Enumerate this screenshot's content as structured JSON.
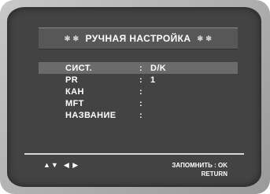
{
  "osd": {
    "title": "РУЧНАЯ НАСТРОЙКА",
    "title_decoration": "✻ ✻",
    "rows": [
      {
        "label": "СИСТ.",
        "colon": ":",
        "value": "D/K"
      },
      {
        "label": "PR",
        "colon": ":",
        "value": "1"
      },
      {
        "label": "КАН",
        "colon": ":",
        "value": ""
      },
      {
        "label": "MFT",
        "colon": ":",
        "value": ""
      },
      {
        "label": "НАЗВАНИЕ",
        "colon": ":",
        "value": ""
      }
    ],
    "footer": {
      "nav_updown": "▲▼",
      "nav_leftright": "◀ ▶",
      "save_hint": "ЗАПОМНИТЬ : OK",
      "return_hint": "RETURN"
    },
    "selected_row": "СИСТ."
  }
}
